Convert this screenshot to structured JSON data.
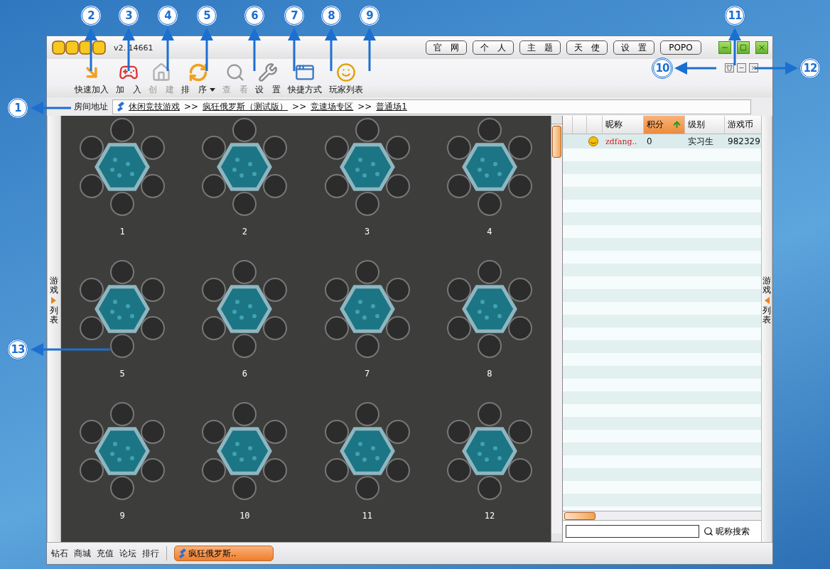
{
  "title_bar": {
    "version": "v2.  14661",
    "buttons": [
      {
        "label": "官　网"
      },
      {
        "label": "个　人"
      },
      {
        "label": "主　题"
      },
      {
        "label": "天　使"
      },
      {
        "label": "设　置"
      },
      {
        "label": "POPO"
      }
    ]
  },
  "toolbar": [
    {
      "label": "快速加入",
      "disabled": false,
      "menu": false
    },
    {
      "label": "加　入",
      "disabled": false,
      "menu": false
    },
    {
      "label": "创　建",
      "disabled": true,
      "menu": false
    },
    {
      "label": "排　序",
      "disabled": false,
      "menu": true
    },
    {
      "label": "查　看",
      "disabled": true,
      "menu": false
    },
    {
      "label": "设　置",
      "disabled": false,
      "menu": false
    },
    {
      "label": "快捷方式",
      "disabled": false,
      "menu": false
    },
    {
      "label": "玩家列表",
      "disabled": false,
      "menu": false
    }
  ],
  "address": {
    "label": "房间地址",
    "separator": ">>",
    "crumbs": [
      "休闲竞技游戏",
      "疯狂俄罗斯（测试版）",
      "竞速场专区",
      "普通场1"
    ]
  },
  "side_toggle_left": {
    "top": "游戏",
    "bottom": "列表"
  },
  "side_toggle_right": {
    "top": "游戏",
    "bottom": "列表"
  },
  "tables": [
    {
      "number": "1"
    },
    {
      "number": "2"
    },
    {
      "number": "3"
    },
    {
      "number": "4"
    },
    {
      "number": "5"
    },
    {
      "number": "6"
    },
    {
      "number": "7"
    },
    {
      "number": "8"
    },
    {
      "number": "9"
    },
    {
      "number": "10"
    },
    {
      "number": "11"
    },
    {
      "number": "12"
    }
  ],
  "player_table": {
    "columns": [
      {
        "label": "昵称",
        "sorted": false
      },
      {
        "label": "积分",
        "sorted": true
      },
      {
        "label": "级别",
        "sorted": false
      },
      {
        "label": "游戏币",
        "sorted": false
      }
    ],
    "rows": [
      {
        "cells": [
          "zdfang..",
          "0",
          "实习生",
          "982329"
        ]
      }
    ]
  },
  "search": {
    "button": "昵称搜索"
  },
  "bottom_bar": {
    "links": [
      "钻石",
      "商城",
      "充值",
      "论坛",
      "排行"
    ],
    "tabs": [
      {
        "label": "疯狂俄罗斯..",
        "selected": true
      }
    ]
  },
  "callouts": [
    {
      "label": "1"
    },
    {
      "label": "2"
    },
    {
      "label": "3"
    },
    {
      "label": "4"
    },
    {
      "label": "5"
    },
    {
      "label": "6"
    },
    {
      "label": "7"
    },
    {
      "label": "8"
    },
    {
      "label": "9"
    },
    {
      "label": "10"
    },
    {
      "label": "11"
    },
    {
      "label": "12"
    },
    {
      "label": "13"
    }
  ]
}
